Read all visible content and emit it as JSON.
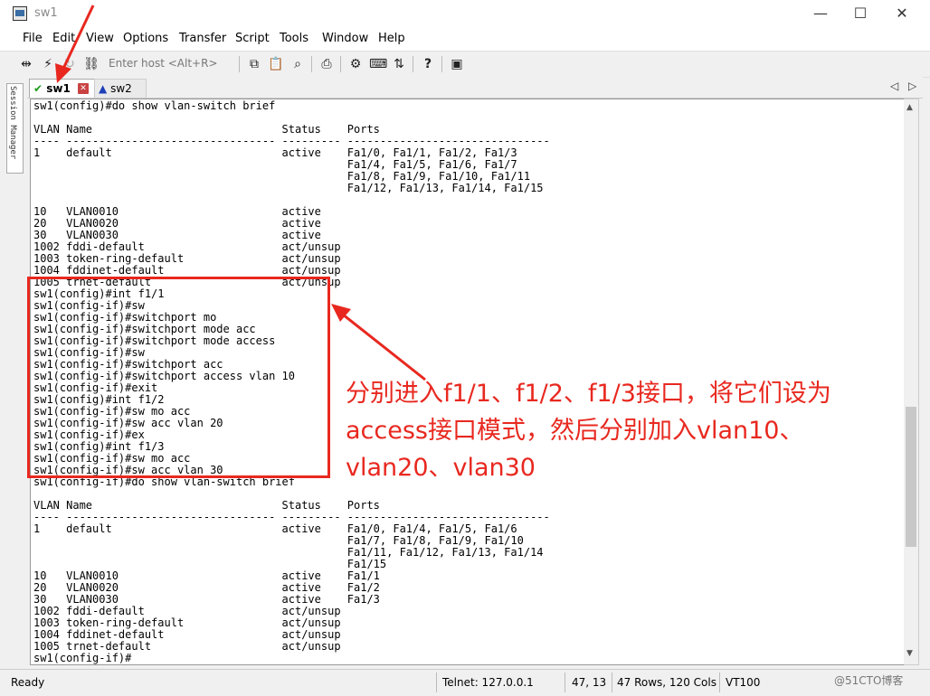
{
  "window": {
    "title": "sw1",
    "minimize": "—",
    "maximize": "☐",
    "close": "✕"
  },
  "menu": [
    "File",
    "Edit",
    "View",
    "Options",
    "Transfer",
    "Script",
    "Tools",
    "Window",
    "Help"
  ],
  "toolbar": {
    "host_placeholder": "Enter host <Alt+R>",
    "help_icon": "?"
  },
  "session_manager_label": "Session Manager",
  "tabs": [
    {
      "label": "sw1",
      "status": "connected",
      "icon": "check-icon"
    },
    {
      "label": "sw2",
      "status": "warning",
      "icon": "warning-icon"
    }
  ],
  "terminal_lines": [
    "sw1(config)#do show vlan-switch brief",
    "",
    "VLAN Name                             Status    Ports",
    "---- -------------------------------- --------- -------------------------------",
    "1    default                          active    Fa1/0, Fa1/1, Fa1/2, Fa1/3",
    "                                                Fa1/4, Fa1/5, Fa1/6, Fa1/7",
    "                                                Fa1/8, Fa1/9, Fa1/10, Fa1/11",
    "                                                Fa1/12, Fa1/13, Fa1/14, Fa1/15",
    "",
    "10   VLAN0010                         active",
    "20   VLAN0020                         active",
    "30   VLAN0030                         active",
    "1002 fddi-default                     act/unsup",
    "1003 token-ring-default               act/unsup",
    "1004 fddinet-default                  act/unsup",
    "1005 trnet-default                    act/unsup",
    "sw1(config)#int f1/1",
    "sw1(config-if)#sw",
    "sw1(config-if)#switchport mo",
    "sw1(config-if)#switchport mode acc",
    "sw1(config-if)#switchport mode access",
    "sw1(config-if)#sw",
    "sw1(config-if)#switchport acc",
    "sw1(config-if)#switchport access vlan 10",
    "sw1(config-if)#exit",
    "sw1(config)#int f1/2",
    "sw1(config-if)#sw mo acc",
    "sw1(config-if)#sw acc vlan 20",
    "sw1(config-if)#ex",
    "sw1(config)#int f1/3",
    "sw1(config-if)#sw mo acc",
    "sw1(config-if)#sw acc vlan 30",
    "sw1(config-if)#do show vlan-switch brief",
    "",
    "VLAN Name                             Status    Ports",
    "---- -------------------------------- --------- -------------------------------",
    "1    default                          active    Fa1/0, Fa1/4, Fa1/5, Fa1/6",
    "                                                Fa1/7, Fa1/8, Fa1/9, Fa1/10",
    "                                                Fa1/11, Fa1/12, Fa1/13, Fa1/14",
    "                                                Fa1/15",
    "10   VLAN0010                         active    Fa1/1",
    "20   VLAN0020                         active    Fa1/2",
    "30   VLAN0030                         active    Fa1/3",
    "1002 fddi-default                     act/unsup",
    "1003 token-ring-default               act/unsup",
    "1004 fddinet-default                  act/unsup",
    "1005 trnet-default                    act/unsup",
    "sw1(config-if)#"
  ],
  "annotation": {
    "line1": "分别进入f1/1、f1/2、f1/3接口，将它们设为",
    "line2": "access接口模式，然后分别加入vlan10、",
    "line3": "vlan20、vlan30",
    "color": "#e8281f"
  },
  "status": {
    "ready": "Ready",
    "connection": "Telnet: 127.0.0.1",
    "cursor": "47, 13",
    "size": "47 Rows, 120 Cols",
    "emulation": "VT100"
  },
  "watermark": "@51CTO博客"
}
